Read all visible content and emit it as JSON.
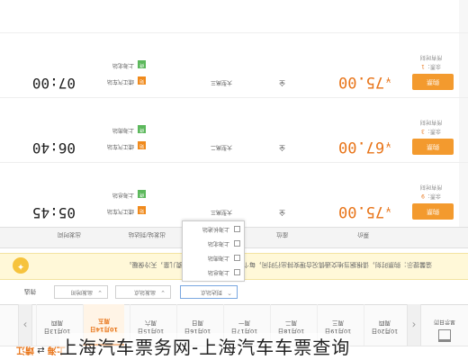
{
  "route": {
    "from": "上海",
    "arrow": "⇄",
    "to": "靖江"
  },
  "calendar_label": "显示日历",
  "date_nav": {
    "prev": "‹",
    "next": "›"
  },
  "days": [
    {
      "date": "10月13日",
      "week": "周四"
    },
    {
      "date": "10月14日",
      "week": "周五"
    },
    {
      "date": "10月15日",
      "week": "周六"
    },
    {
      "date": "10月16日",
      "week": "周日"
    },
    {
      "date": "10月17日",
      "week": "周一"
    },
    {
      "date": "10月18日",
      "week": "周二"
    },
    {
      "date": "10月19日",
      "week": "周三"
    },
    {
      "date": "10月20日",
      "week": "周四"
    }
  ],
  "filters": {
    "label": "筛选",
    "depart_time": "出发时间",
    "depart_station": "出发站点",
    "arrive_station": "到达站点"
  },
  "dropdown_options": [
    "上海总站",
    "上海南站",
    "上海北站",
    "上海长途站"
  ],
  "tip": "温馨提示：购票时刻，请根据当地交通情况合理安排出行时间，每个订单至多可携带1个免费儿童，天冷保暖。",
  "table_header": {
    "depart_time": "出发时间",
    "stations": "出发站/到达站",
    "bus_type": "车型",
    "seat": "座位",
    "price": "票价"
  },
  "rows": [
    {
      "time": "05:45",
      "depart_station": "靖江汽车站",
      "arrive_station": "上海总站",
      "bus_type": "大型高三",
      "seat": "全",
      "price": "75.00",
      "buy_label": "购票",
      "remain_label": "余票：",
      "remain_count": "9",
      "remain_note": "所有时刻"
    },
    {
      "time": "06:40",
      "depart_station": "靖江汽车站",
      "arrive_station": "上海南站",
      "bus_type": "大型高二",
      "seat": "全",
      "price": "67.00",
      "buy_label": "购票",
      "remain_label": "余票：",
      "remain_count": "3",
      "remain_note": "所有时刻"
    },
    {
      "time": "07:00",
      "depart_station": "靖江汽车站",
      "arrive_station": "上海北站",
      "bus_type": "大型高三",
      "seat": "全",
      "price": "75.00",
      "buy_label": "购票",
      "remain_label": "余票：",
      "remain_count": "1",
      "remain_note": "所有时刻"
    }
  ],
  "caption": "上海汽车票务网-上海汽车车票查询",
  "colors": {
    "accent": "#e8751a",
    "button": "#f39a2e",
    "tip_bg": "#fff8d8"
  }
}
